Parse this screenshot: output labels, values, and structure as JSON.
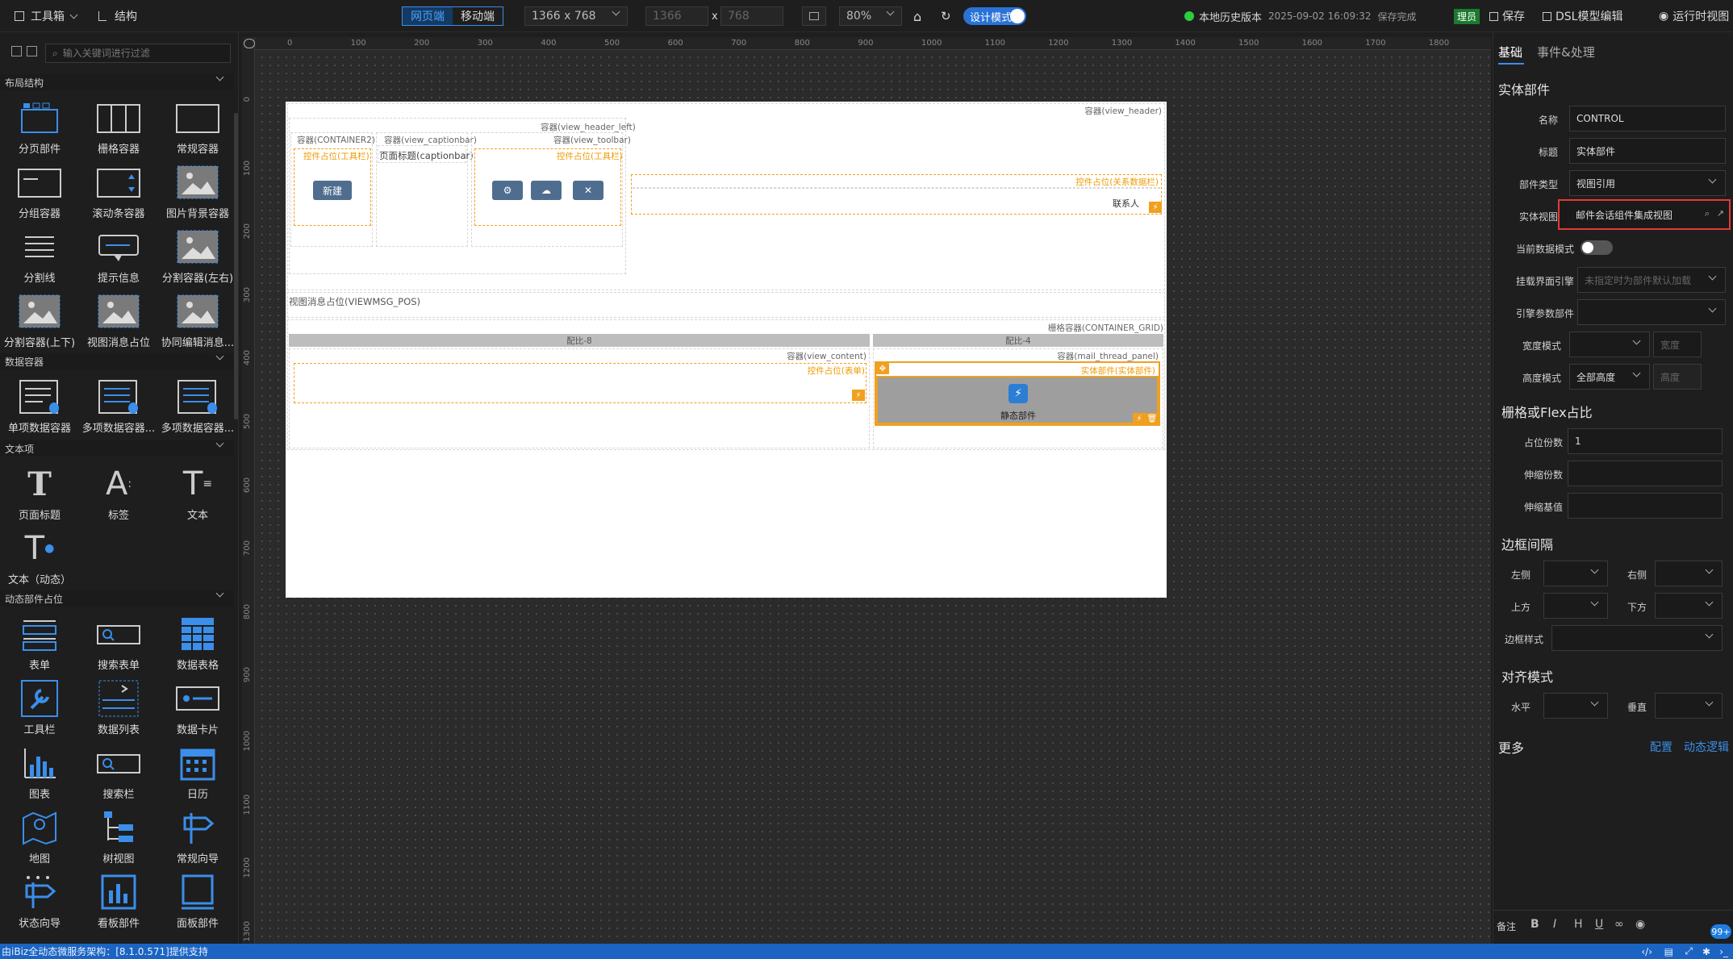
{
  "topbar": {
    "toolbox": "工具箱",
    "structure": "结构",
    "mode_web": "网页端",
    "mode_mobile": "移动端",
    "resolution": "1366 x 768",
    "width": "1366",
    "x": "x",
    "height": "768",
    "zoom": "80%",
    "design_mode": "设计模式",
    "history_label": "本地历史版本",
    "history_time": "2025-09-02 16:09:32",
    "saved": "保存完成",
    "role": "理员",
    "save": "保存",
    "dsl": "DSL模型编辑",
    "runtime": "运行时视图"
  },
  "left": {
    "search_placeholder": "输入关键词进行过滤",
    "sections": [
      {
        "title": "布局结构",
        "items": [
          "分页部件",
          "栅格容器",
          "常规容器",
          "分组容器",
          "滚动条容器",
          "图片背景容器",
          "分割线",
          "提示信息",
          "分割容器(左右)",
          "分割容器(上下)",
          "视图消息占位",
          "协同编辑消息..."
        ]
      },
      {
        "title": "数据容器",
        "items": [
          "单项数据容器",
          "多项数据容器...",
          "多项数据容器..."
        ]
      },
      {
        "title": "文本项",
        "items": [
          "页面标题",
          "标签",
          "文本",
          "文本（动态）"
        ]
      },
      {
        "title": "动态部件占位",
        "items": [
          "表单",
          "搜索表单",
          "数据表格",
          "工具栏",
          "数据列表",
          "数据卡片",
          "图表",
          "搜索栏",
          "日历",
          "地图",
          "树视图",
          "常规向导",
          "状态向导",
          "看板部件",
          "面板部件"
        ]
      }
    ]
  },
  "ruler": {
    "h": [
      "0",
      "100",
      "200",
      "300",
      "400",
      "500",
      "600",
      "700",
      "800",
      "900",
      "1000",
      "1100",
      "1200",
      "1300",
      "1400",
      "1500",
      "1600",
      "1700",
      "1800"
    ],
    "v": [
      "0",
      "100",
      "200",
      "300",
      "400",
      "500",
      "600",
      "700",
      "800",
      "900",
      "1000",
      "1100",
      "1200",
      "1300"
    ]
  },
  "page": {
    "view_header": "容器(view_header)",
    "view_header_left": "容器(view_header_left)",
    "container2": "容器(CONTAINER2)",
    "captionbar_container": "容器(view_captionbar)",
    "toolbar_container": "容器(view_toolbar)",
    "toolbar_placeholder_1": "控件占位(工具栏)",
    "caption_text": "页面标题(captionbar)",
    "toolbar_placeholder_2": "控件占位(工具栏)",
    "new_button": "新建",
    "relation_placeholder": "控件占位(关系数据栏)",
    "contact": "联系人",
    "viewmsg": "视图消息占位(VIEWMSG_POS)",
    "grid_container": "栅格容器(CONTAINER_GRID)",
    "col_left": "配比-8",
    "col_right": "配比-4",
    "view_content": "容器(view_content)",
    "form_placeholder": "控件占位(表单)",
    "mail_thread": "容器(mail_thread_panel)",
    "entity_placeholder": "实体部件(实体部件)",
    "static_part": "静态部件"
  },
  "right": {
    "tab_basic": "基础",
    "tab_events": "事件&处理",
    "section_entity": "实体部件",
    "name_label": "名称",
    "name_value": "CONTROL",
    "title_label": "标题",
    "title_value": "实体部件",
    "type_label": "部件类型",
    "type_value": "视图引用",
    "entity_view_label": "实体视图",
    "entity_view_value": "邮件会话组件集成视图",
    "data_mode_label": "当前数据模式",
    "engine_label": "挂载界面引擎",
    "engine_placeholder": "未指定时为部件默认加载",
    "param_label": "引擎参数部件",
    "width_mode_label": "宽度模式",
    "width_placeholder": "宽度",
    "height_mode_label": "高度模式",
    "height_mode_value": "全部高度",
    "height_placeholder": "高度",
    "section_grid": "栅格或Flex占比",
    "span_label": "占位份数",
    "span_value": "1",
    "grow_label": "伸缩份数",
    "basis_label": "伸缩基值",
    "section_border": "边框间隔",
    "left_label": "左侧",
    "right_label": "右侧",
    "top_label": "上方",
    "bottom_label": "下方",
    "border_style_label": "边框样式",
    "section_align": "对齐模式",
    "h_label": "水平",
    "v_label": "垂直",
    "section_more": "更多",
    "config": "配置",
    "dynamic_logic": "动态逻辑",
    "note_label": "备注",
    "fmt": [
      "B",
      "I",
      "H",
      "U"
    ]
  },
  "status": {
    "text": "由iBiz全动态微服务架构：[8.1.0.571]提供支持",
    "badge": "99+"
  },
  "colors": {
    "accent": "#3b8eea",
    "orange": "#f0a020",
    "highlight": "#e53935"
  }
}
